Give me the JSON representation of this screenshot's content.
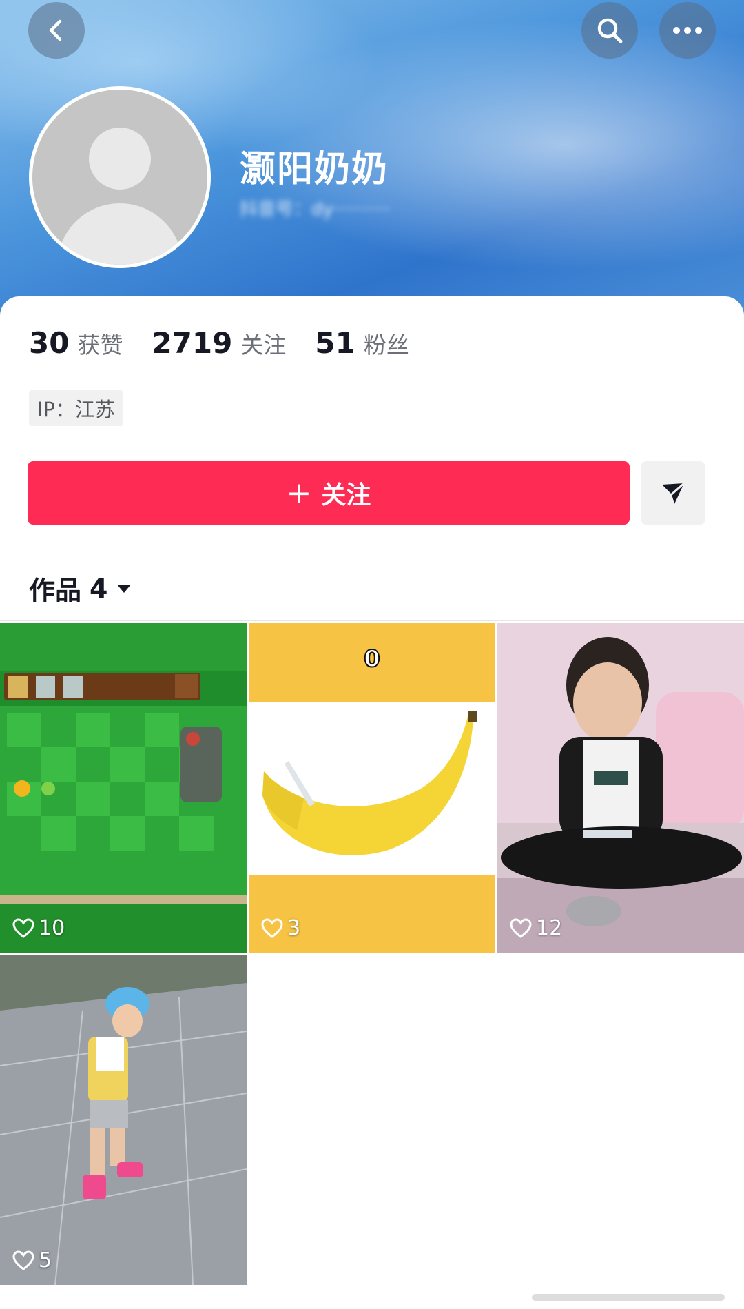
{
  "profile": {
    "name": "灏阳奶奶",
    "douyin_id": "抖音号：dy··········"
  },
  "stats": {
    "likes_count": "30",
    "likes_label": "获赞",
    "following_count": "2719",
    "following_label": "关注",
    "followers_count": "51",
    "followers_label": "粉丝"
  },
  "ip": {
    "label": "IP：江苏"
  },
  "actions": {
    "follow_plus": "+",
    "follow_label": "关注"
  },
  "works": {
    "label": "作品",
    "count": "4"
  },
  "videos": [
    {
      "likes": "10"
    },
    {
      "likes": "3",
      "overlay_counter": "0"
    },
    {
      "likes": "12"
    },
    {
      "likes": "5"
    }
  ],
  "icons": {
    "back": "chevron-left-icon",
    "search": "search-icon",
    "more": "more-icon",
    "share": "send-icon",
    "heart": "heart-icon",
    "caret": "caret-down-icon"
  },
  "colors": {
    "accent": "#fe2c55",
    "header_blue": "#2f74cc"
  }
}
